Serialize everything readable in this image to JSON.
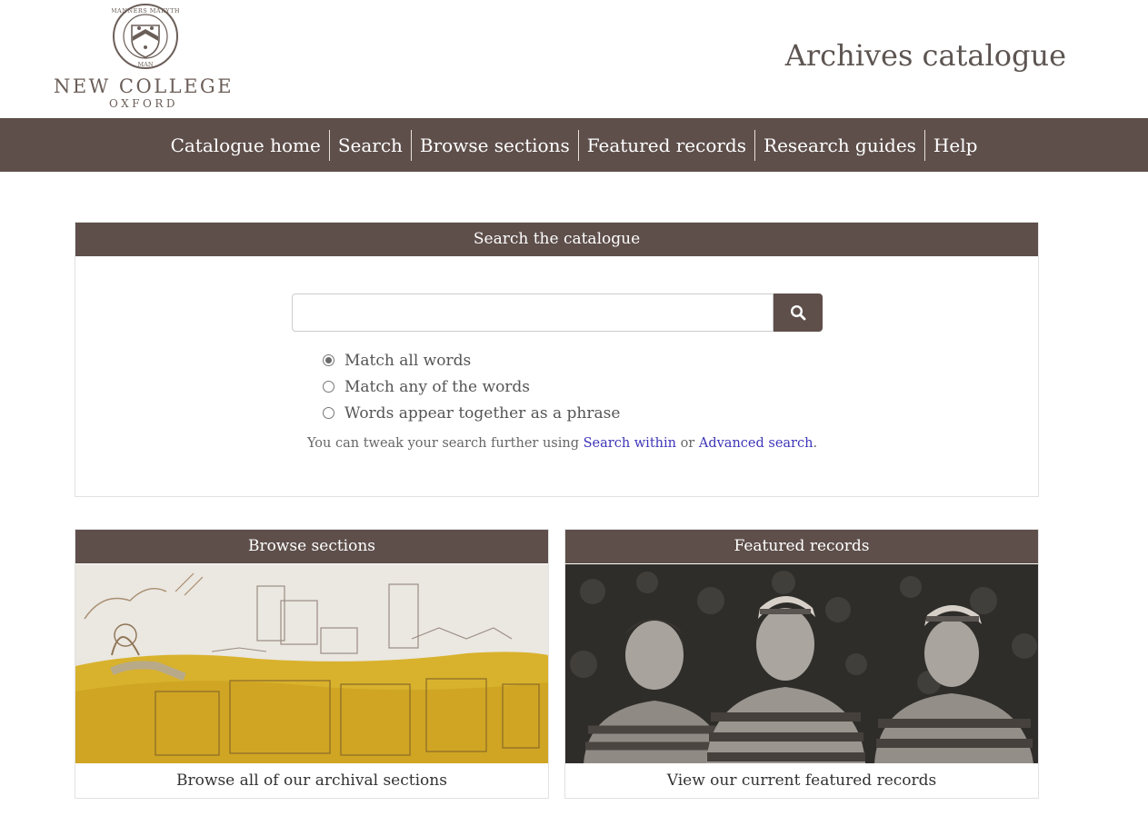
{
  "header": {
    "college_name": "NEW COLLEGE",
    "college_sub": "OXFORD",
    "motto": "MANNERS MAKYTH MAN",
    "site_title": "Archives catalogue"
  },
  "nav": {
    "items": [
      {
        "label": "Catalogue home"
      },
      {
        "label": "Search"
      },
      {
        "label": "Browse sections"
      },
      {
        "label": "Featured records"
      },
      {
        "label": "Research guides"
      },
      {
        "label": "Help"
      }
    ]
  },
  "search": {
    "heading": "Search the catalogue",
    "query": "",
    "placeholder": "",
    "button_icon": "search-icon",
    "options": [
      {
        "label": "Match all words",
        "checked": true
      },
      {
        "label": "Match any of the words",
        "checked": false
      },
      {
        "label": "Words appear together as a phrase",
        "checked": false
      }
    ],
    "tweak_prefix": "You can tweak your search further using ",
    "link_within": "Search within",
    "tweak_or": " or ",
    "link_advanced": "Advanced search",
    "tweak_suffix": "."
  },
  "cards": {
    "browse": {
      "heading": "Browse sections",
      "caption": "Browse all of our archival sections"
    },
    "featured": {
      "heading": "Featured records",
      "caption": "View our current featured records"
    }
  },
  "colors": {
    "brand": "#5e4f4b",
    "link": "#3d35b8"
  }
}
